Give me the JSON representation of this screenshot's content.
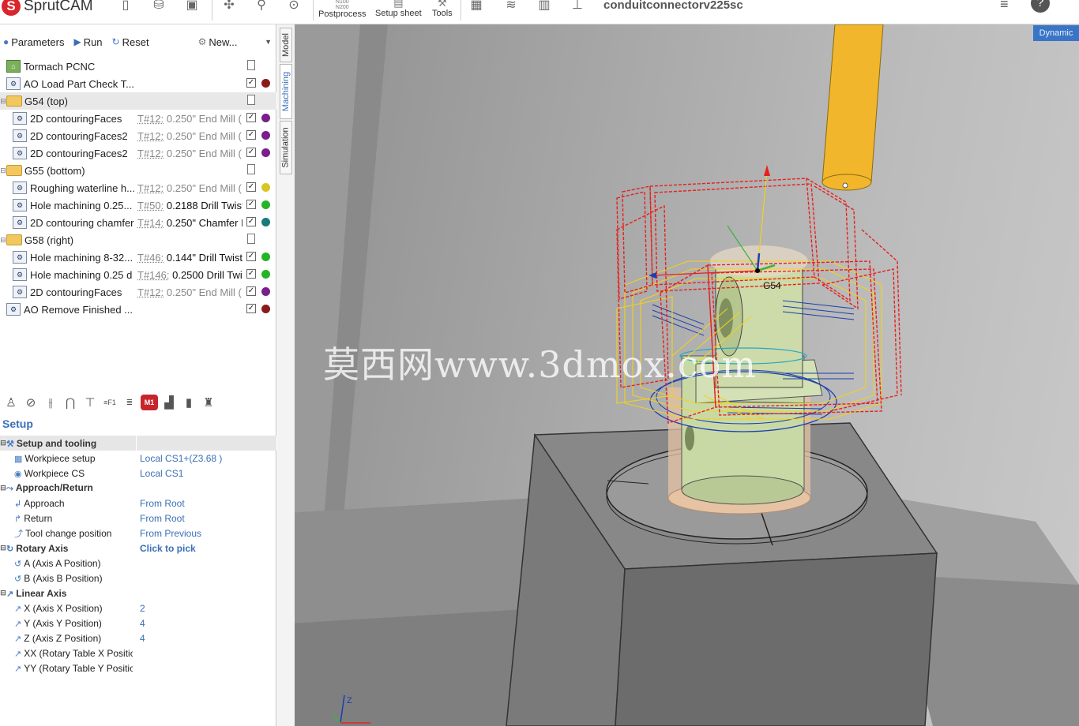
{
  "app": {
    "name": "SprutCAM",
    "document_title": "conduitconnectorv225sc"
  },
  "toolbar": {
    "buttons": [
      {
        "label": "Postprocess",
        "icon": "postprocess-icon",
        "glyph_top": "N100\nN200"
      },
      {
        "label": "Setup sheet",
        "icon": "setup-sheet-icon"
      },
      {
        "label": "Tools",
        "icon": "tools-icon"
      }
    ]
  },
  "subbar": {
    "parameters": "Parameters",
    "run": "Run",
    "reset": "Reset",
    "new": "New..."
  },
  "tree": [
    {
      "kind": "machine",
      "name": "Tormach PCNC",
      "indent": 0
    },
    {
      "kind": "op",
      "name": "AO Load Part Check T...",
      "indent": 1,
      "tool": "",
      "dot": "#8b1a1a"
    },
    {
      "kind": "group",
      "name": "G54 (top)",
      "indent": 0,
      "selected": true
    },
    {
      "kind": "op",
      "name": "2D contouringFaces",
      "indent": 2,
      "tool_no": "T#12:",
      "tool": "0.250\" End Mill (",
      "dark": false,
      "dot": "#7a1f8a"
    },
    {
      "kind": "op",
      "name": "2D contouringFaces2",
      "indent": 2,
      "tool_no": "T#12:",
      "tool": "0.250\" End Mill (",
      "dark": false,
      "dot": "#7a1f8a"
    },
    {
      "kind": "op",
      "name": "2D contouringFaces2",
      "indent": 2,
      "tool_no": "T#12:",
      "tool": "0.250\" End Mill (",
      "dark": false,
      "dot": "#7a1f8a"
    },
    {
      "kind": "group",
      "name": "G55 (bottom)",
      "indent": 0
    },
    {
      "kind": "op",
      "name": "Roughing waterline h...",
      "indent": 2,
      "tool_no": "T#12:",
      "tool": "0.250\" End Mill (",
      "dark": false,
      "dot": "#d8c623"
    },
    {
      "kind": "op",
      "name": "Hole machining 0.25...",
      "indent": 2,
      "tool_no": "T#50:",
      "tool": "0.2188 Drill Twist",
      "dark": true,
      "dot": "#25b425"
    },
    {
      "kind": "op",
      "name": "2D contouring chamfer",
      "indent": 2,
      "tool_no": "T#14:",
      "tool": "0.250\" Chamfer M",
      "dark": true,
      "dot": "#1a7a7a"
    },
    {
      "kind": "group",
      "name": "G58 (right)",
      "indent": 0
    },
    {
      "kind": "op",
      "name": "Hole machining 8-32...",
      "indent": 2,
      "tool_no": "T#46:",
      "tool": "0.144\" Drill Twist",
      "dark": true,
      "dot": "#25b425"
    },
    {
      "kind": "op",
      "name": "Hole machining 0.25 d",
      "indent": 2,
      "tool_no": "T#146:",
      "tool": "0.2500 Drill Twi",
      "dark": true,
      "dot": "#25b425"
    },
    {
      "kind": "op",
      "name": "2D contouringFaces",
      "indent": 2,
      "tool_no": "T#12:",
      "tool": "0.250\" End Mill (",
      "dark": false,
      "dot": "#7a1f8a"
    },
    {
      "kind": "op",
      "name": "AO Remove Finished ...",
      "indent": 1,
      "tool": "",
      "dot": "#8b1a1a"
    }
  ],
  "setup_title": "Setup",
  "properties": [
    {
      "type": "group",
      "header": true,
      "name": "Setup and tooling",
      "value": ""
    },
    {
      "type": "item",
      "name": "Workpiece setup",
      "value": "Local CS1+(Z3.68 )"
    },
    {
      "type": "item",
      "name": "Workpiece CS",
      "value": "Local CS1"
    },
    {
      "type": "group",
      "name": "Approach/Return",
      "value": ""
    },
    {
      "type": "item",
      "name": "Approach",
      "value": "From Root"
    },
    {
      "type": "item",
      "name": "Return",
      "value": "From Root"
    },
    {
      "type": "item",
      "name": "Tool change position",
      "value": "From Previous"
    },
    {
      "type": "group",
      "name": "Rotary Axis",
      "value": "Click to pick"
    },
    {
      "type": "item",
      "name": "A (Axis A Position)",
      "value": ""
    },
    {
      "type": "item",
      "name": "B (Axis B Position)",
      "value": ""
    },
    {
      "type": "group",
      "name": "Linear Axis",
      "value": ""
    },
    {
      "type": "item",
      "name": "X (Axis X Position)",
      "value": "2"
    },
    {
      "type": "item",
      "name": "Y (Axis Y Position)",
      "value": "4"
    },
    {
      "type": "item",
      "name": "Z (Axis Z Position)",
      "value": "4"
    },
    {
      "type": "item",
      "name": "XX (Rotary Table X Positic",
      "value": ""
    },
    {
      "type": "item",
      "name": "YY (Rotary Table Y Positic",
      "value": ""
    }
  ],
  "vtabs": {
    "model": "Model",
    "machining": "Machining",
    "simulation": "Simulation"
  },
  "viewport": {
    "mode_badge": "Dynamic",
    "cs_label": "G54",
    "watermark": "莫西网www.3dmox.com",
    "axis_label": "Z"
  },
  "colors": {
    "accent": "#3a74c6",
    "toolpath_red": "#e8201e",
    "toolpath_yellow": "#f2d21c",
    "part": "#c9d9a6",
    "tool": "#f1b62c"
  }
}
